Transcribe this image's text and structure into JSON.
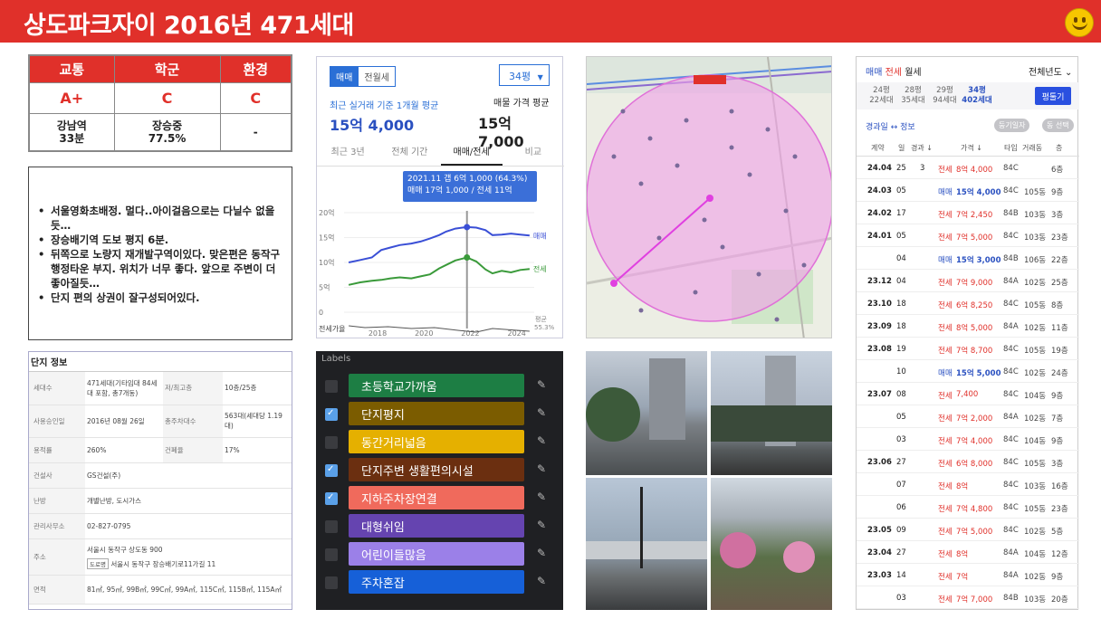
{
  "header": {
    "title": "상도파크자이  2016년 471세대"
  },
  "ratings": {
    "headers": [
      "교통",
      "학군",
      "환경"
    ],
    "grades": [
      "A+",
      "C",
      "C"
    ],
    "details": [
      [
        "강남역",
        "33분"
      ],
      [
        "장승중",
        "77.5%"
      ],
      [
        "-"
      ]
    ]
  },
  "notes": [
    "서울영화초배정. 멀다..아이걸음으로는  다닐수 없을듯…",
    "장승배기역 도보 평지 6분.",
    "뒤쪽으로 노량지 재개발구역이있다. 맞은편은 동작구 행정타운 부지. 위치가 너무 좋다.  앞으로 주변이 더좋아질듯…",
    "단지 편의 상권이 잘구성되어있다."
  ],
  "info": {
    "title": "단지 정보",
    "rows": [
      {
        "k": "세대수",
        "v": "471세대(기타임대 84세대 포함, 총7개동)",
        "k2": "저/최고층",
        "v2": "10층/25층"
      },
      {
        "k": "사용승인일",
        "v": "2016년 08월 26일",
        "k2": "총주차대수",
        "v2": "563대(세대당 1.19대)"
      },
      {
        "k": "용적률",
        "v": "260%",
        "k2": "건폐율",
        "v2": "17%"
      },
      {
        "k": "건설사",
        "v": "GS건설(주)"
      },
      {
        "k": "난방",
        "v": "개별난방, 도시가스"
      },
      {
        "k": "관리사무소",
        "v": "02-827-0795"
      },
      {
        "k": "주소",
        "v": "서울시 동작구 상도동 900",
        "tag": "도로명",
        "v3": "서울시 동작구 장승배기로11가길 11"
      },
      {
        "k": "면적",
        "v": "81㎡, 95㎡, 99B㎡, 99C㎡, 99A㎡, 115C㎡, 115B㎡, 115A㎡"
      }
    ]
  },
  "price": {
    "tab_sale": "매매",
    "tab_jeonse": "전월세",
    "size": "34평",
    "recent_label": "최근 실거래 기준 1개월 평균",
    "recent_value": "15억 4,000",
    "listing_label": "매물 가격 평균",
    "listing_value": "15억 7,000",
    "periods": [
      "최근 3년",
      "전체 기간",
      "매매/전세",
      "비교"
    ],
    "tooltip": [
      "2021.11  갭 6억 1,000 (64.3%)",
      "매매 17억 1,000 / 전세 11억"
    ]
  },
  "chart_data": {
    "type": "line",
    "x_ticks": [
      "2018",
      "2020",
      "2022",
      "2024"
    ],
    "y_ticks": [
      "20억",
      "15억",
      "10억",
      "5억",
      "0"
    ],
    "ylim": [
      0,
      20
    ],
    "series": [
      {
        "name": "매매",
        "color": "#3a4fd6",
        "x": [
          2016.8,
          2017.3,
          2017.8,
          2018.2,
          2018.6,
          2019.0,
          2019.5,
          2019.9,
          2020.3,
          2020.7,
          2021.0,
          2021.4,
          2021.9,
          2022.3,
          2022.7,
          2023.0,
          2023.4,
          2023.8,
          2024.2,
          2024.6
        ],
        "y": [
          10,
          10.5,
          11,
          12.5,
          13,
          13.5,
          13.8,
          14.2,
          14.8,
          15.5,
          16.2,
          16.8,
          17.1,
          17.0,
          16.5,
          15.5,
          15.6,
          15.8,
          15.6,
          15.4
        ]
      },
      {
        "name": "전세",
        "color": "#3a9a3a",
        "x": [
          2016.8,
          2017.3,
          2017.8,
          2018.2,
          2018.6,
          2019.0,
          2019.5,
          2019.9,
          2020.3,
          2020.7,
          2021.0,
          2021.4,
          2021.9,
          2022.3,
          2022.7,
          2023.0,
          2023.4,
          2023.8,
          2024.2,
          2024.6
        ],
        "y": [
          5.5,
          6,
          6.3,
          6.5,
          6.8,
          7,
          6.8,
          7.2,
          7.6,
          8.8,
          9.5,
          10.4,
          11,
          10.2,
          8.6,
          7.8,
          8.3,
          8.0,
          8.5,
          8.7
        ]
      }
    ],
    "jeonse_ratio_label": "전세가율",
    "jeonse_ratio_end": "55.3%",
    "ratio_end_label": "평균"
  },
  "labels": {
    "title": "Labels",
    "items": [
      {
        "text": "초등학교가까움",
        "color": "#1d7e44",
        "checked": false
      },
      {
        "text": "단지평지",
        "color": "#7b5c00",
        "checked": true
      },
      {
        "text": "동간거리넓음",
        "color": "#e5b000",
        "checked": false
      },
      {
        "text": "단지주변 생활편의시설",
        "color": "#6b2f10",
        "checked": true
      },
      {
        "text": "지하주차장연결",
        "color": "#f06a5c",
        "checked": true
      },
      {
        "text": "대형쉬임",
        "color": "#6544b0",
        "checked": false
      },
      {
        "text": "어린이들많음",
        "color": "#9b80e8",
        "checked": false
      },
      {
        "text": "주차혼잡",
        "color": "#1660d8",
        "checked": false
      }
    ]
  },
  "trades": {
    "tabs": [
      "매매",
      "전세",
      "월세"
    ],
    "period": "전체년도",
    "sizes": [
      [
        "24평",
        "22세대"
      ],
      [
        "28평",
        "35세대"
      ],
      [
        "29평",
        "94세대"
      ],
      [
        "34평",
        "402세대"
      ]
    ],
    "button": "평툴기",
    "legend": "경과일 ↔ 정보",
    "opt1": "둥기일자",
    "opt2": "동 선택",
    "cols": [
      "계약",
      "일",
      "경과 ↓",
      "가격 ↓",
      "타입",
      "거래동",
      "층"
    ],
    "rows": [
      {
        "ym": "24.04",
        "d": "25",
        "e": "3",
        "t": "전세",
        "p": "8억 4,000",
        "ty": "84C",
        "dong": "",
        "fl": "6층"
      },
      {
        "ym": "24.03",
        "d": "05",
        "e": "",
        "t": "매매",
        "p": "15억 4,000",
        "ty": "84C",
        "dong": "105동",
        "fl": "9층"
      },
      {
        "ym": "24.02",
        "d": "17",
        "e": "",
        "t": "전세",
        "p": "7억 2,450",
        "ty": "84B",
        "dong": "103동",
        "fl": "3층"
      },
      {
        "ym": "24.01",
        "d": "05",
        "e": "",
        "t": "전세",
        "p": "7억 5,000",
        "ty": "84C",
        "dong": "103동",
        "fl": "23층"
      },
      {
        "ym": "",
        "d": "04",
        "e": "",
        "t": "매매",
        "p": "15억 3,000",
        "ty": "84B",
        "dong": "106동",
        "fl": "22층"
      },
      {
        "ym": "23.12",
        "d": "04",
        "e": "",
        "t": "전세",
        "p": "7억 9,000",
        "ty": "84A",
        "dong": "102동",
        "fl": "25층"
      },
      {
        "ym": "23.10",
        "d": "18",
        "e": "",
        "t": "전세",
        "p": "6억 8,250",
        "ty": "84C",
        "dong": "105동",
        "fl": "8층"
      },
      {
        "ym": "23.09",
        "d": "18",
        "e": "",
        "t": "전세",
        "p": "8억 5,000",
        "ty": "84A",
        "dong": "102동",
        "fl": "11층"
      },
      {
        "ym": "23.08",
        "d": "19",
        "e": "",
        "t": "전세",
        "p": "7억 8,700",
        "ty": "84C",
        "dong": "105동",
        "fl": "19층"
      },
      {
        "ym": "",
        "d": "10",
        "e": "",
        "t": "매매",
        "p": "15억 5,000",
        "ty": "84C",
        "dong": "102동",
        "fl": "24층"
      },
      {
        "ym": "23.07",
        "d": "08",
        "e": "",
        "t": "전세",
        "p": "7,400",
        "ty": "84C",
        "dong": "104동",
        "fl": "9층"
      },
      {
        "ym": "",
        "d": "05",
        "e": "",
        "t": "전세",
        "p": "7억 2,000",
        "ty": "84A",
        "dong": "102동",
        "fl": "7층"
      },
      {
        "ym": "",
        "d": "03",
        "e": "",
        "t": "전세",
        "p": "7억 4,000",
        "ty": "84C",
        "dong": "104동",
        "fl": "9층"
      },
      {
        "ym": "23.06",
        "d": "27",
        "e": "",
        "t": "전세",
        "p": "6억 8,000",
        "ty": "84C",
        "dong": "105동",
        "fl": "3층"
      },
      {
        "ym": "",
        "d": "07",
        "e": "",
        "t": "전세",
        "p": "8억",
        "ty": "84C",
        "dong": "103동",
        "fl": "16층"
      },
      {
        "ym": "",
        "d": "06",
        "e": "",
        "t": "전세",
        "p": "7억 4,800",
        "ty": "84C",
        "dong": "105동",
        "fl": "23층"
      },
      {
        "ym": "23.05",
        "d": "09",
        "e": "",
        "t": "전세",
        "p": "7억 5,000",
        "ty": "84C",
        "dong": "102동",
        "fl": "5층"
      },
      {
        "ym": "23.04",
        "d": "27",
        "e": "",
        "t": "전세",
        "p": "8억",
        "ty": "84A",
        "dong": "104동",
        "fl": "12층"
      },
      {
        "ym": "23.03",
        "d": "14",
        "e": "",
        "t": "전세",
        "p": "7억",
        "ty": "84A",
        "dong": "102동",
        "fl": "9층"
      },
      {
        "ym": "",
        "d": "03",
        "e": "",
        "t": "전세",
        "p": "7억 7,000",
        "ty": "84B",
        "dong": "103동",
        "fl": "20층"
      }
    ]
  }
}
